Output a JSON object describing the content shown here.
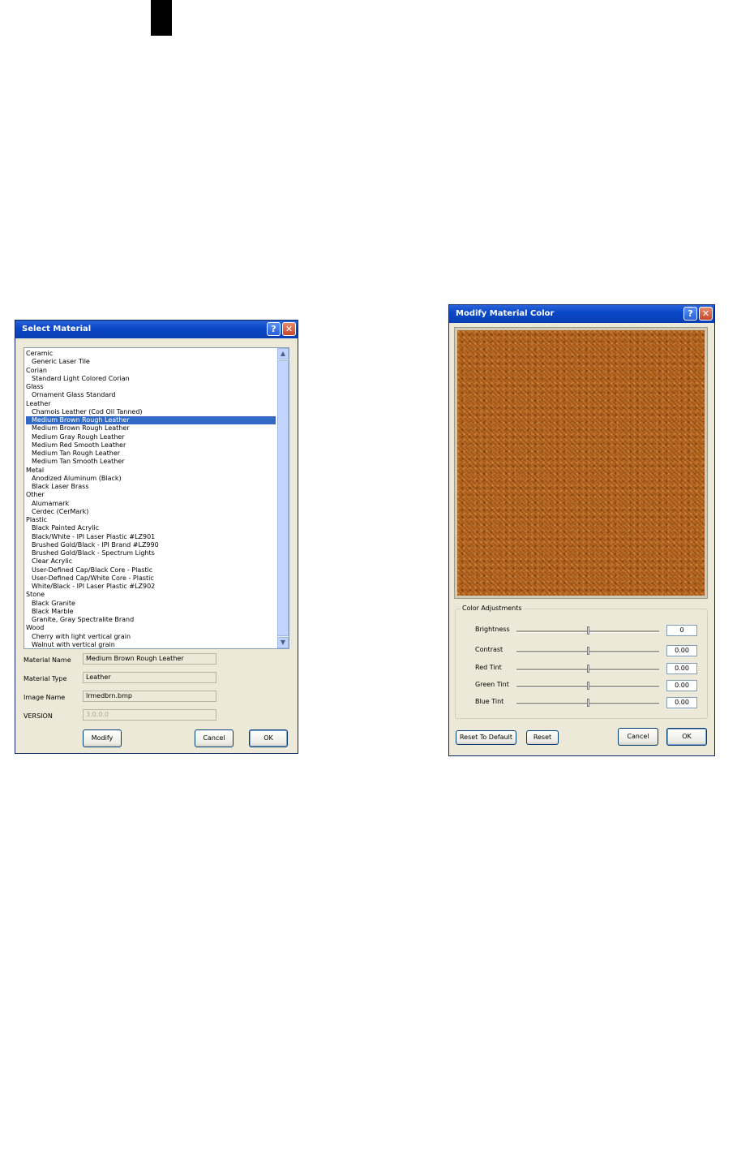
{
  "select_material": {
    "title": "Select Material",
    "help_glyph": "?",
    "close_glyph": "✕",
    "list": [
      {
        "text": "Ceramic",
        "category": true
      },
      {
        "text": "Generic Laser Tile"
      },
      {
        "text": "Corian",
        "category": true
      },
      {
        "text": "Standard Light Colored Corian"
      },
      {
        "text": "Glass",
        "category": true
      },
      {
        "text": "Ornament Glass Standard"
      },
      {
        "text": "Leather",
        "category": true
      },
      {
        "text": "Chamois Leather (Cod Oil Tanned)"
      },
      {
        "text": "Medium Brown Rough Leather",
        "selected": true
      },
      {
        "text": "Medium Brown Rough Leather"
      },
      {
        "text": "Medium Gray Rough Leather"
      },
      {
        "text": "Medium Red Smooth Leather"
      },
      {
        "text": "Medium Tan Rough Leather"
      },
      {
        "text": "Medium Tan Smooth Leather"
      },
      {
        "text": "Metal",
        "category": true
      },
      {
        "text": "Anodized Aluminum (Black)"
      },
      {
        "text": "Black Laser Brass"
      },
      {
        "text": "Other",
        "category": true
      },
      {
        "text": "Alumamark"
      },
      {
        "text": "Cerdec (CerMark)"
      },
      {
        "text": "Plastic",
        "category": true
      },
      {
        "text": "Black Painted Acrylic"
      },
      {
        "text": "Black/White - IPI Laser Plastic #LZ901"
      },
      {
        "text": "Brushed Gold/Black - IPI Brand #LZ990"
      },
      {
        "text": "Brushed Gold/Black - Spectrum Lights"
      },
      {
        "text": "Clear Acrylic"
      },
      {
        "text": "User-Defined Cap/Black Core - Plastic"
      },
      {
        "text": "User-Defined Cap/White Core - Plastic"
      },
      {
        "text": "White/Black - IPI Laser Plastic #LZ902"
      },
      {
        "text": "Stone",
        "category": true
      },
      {
        "text": "Black Granite"
      },
      {
        "text": "Black Marble"
      },
      {
        "text": "Granite, Gray Spectralite Brand"
      },
      {
        "text": "Wood",
        "category": true
      },
      {
        "text": "Cherry with light vertical grain"
      },
      {
        "text": "Walnut with vertical grain"
      }
    ],
    "fields": {
      "material_name_label": "Material Name",
      "material_name": "Medium Brown Rough Leather",
      "material_type_label": "Material Type",
      "material_type": "Leather",
      "image_name_label": "Image Name",
      "image_name": "lrmedbrn.bmp",
      "version_label": "VERSION",
      "version": "3.0.0.0"
    },
    "buttons": {
      "modify": "Modify",
      "cancel": "Cancel",
      "ok": "OK"
    }
  },
  "modify_color": {
    "title": "Modify Material Color",
    "help_glyph": "?",
    "close_glyph": "✕",
    "group_title": "Color Adjustments",
    "adjustments": [
      {
        "label": "Brightness",
        "value": "0",
        "level": 0.5
      },
      {
        "label": "Contrast",
        "value": "0.00",
        "level": 0.5
      },
      {
        "label": "Red Tint",
        "value": "0.00",
        "level": 0.5
      },
      {
        "label": "Green Tint",
        "value": "0.00",
        "level": 0.5
      },
      {
        "label": "Blue Tint",
        "value": "0.00",
        "level": 0.5
      }
    ],
    "buttons": {
      "reset_default": "Reset To Default",
      "reset": "Reset",
      "cancel": "Cancel",
      "ok": "OK"
    }
  }
}
